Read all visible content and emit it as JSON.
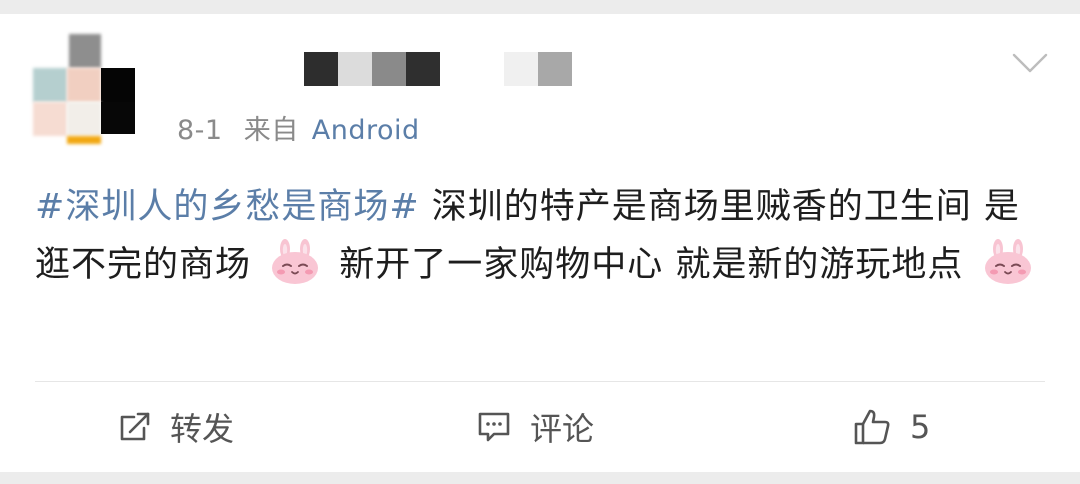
{
  "post": {
    "meta": {
      "time": "8-1",
      "source_prefix": "来自",
      "device": "Android"
    },
    "hashtag": "#深圳人的乡愁是商场#",
    "text_1": " 深圳的特产是商场里贼香的卫生间  是逛不完的商场 ",
    "text_2": " 新开了一家购物中心  就是新的游玩地点 ",
    "emoji_icon": "pink-bunny-smile-icon"
  },
  "actions": {
    "repost_label": "转发",
    "comment_label": "评论",
    "like_count": "5"
  },
  "colors": {
    "link": "#5b7ea8",
    "text": "#1e1e1e",
    "meta": "#8a8a8a",
    "background": "#ececec"
  }
}
